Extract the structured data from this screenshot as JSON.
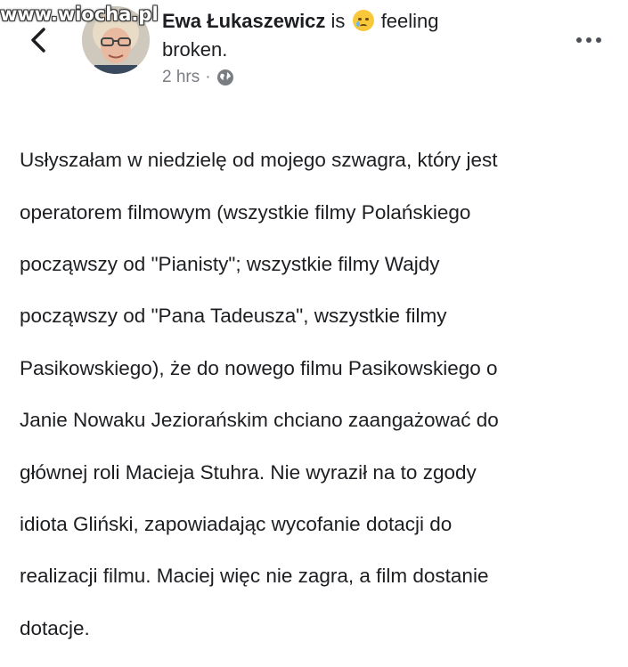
{
  "watermark": "www.wiocha.pl",
  "header": {
    "author_name": "Ewa Łukaszewicz",
    "is_text": "is",
    "feeling_emoji": "crying-face-icon",
    "feeling_text_1": "feeling",
    "feeling_text_2": "broken."
  },
  "meta": {
    "time": "2 hrs",
    "separator": "·",
    "privacy_icon": "globe-icon"
  },
  "post": {
    "lines": [
      "Usłyszałam w niedzielę od mojego szwagra, który jest",
      "operatorem filmowym (wszystkie filmy Polańskiego",
      "począwszy od \"Pianisty\"; wszystkie filmy Wajdy",
      "począwszy od \"Pana Tadeusza\", wszystkie filmy",
      "Pasikowskiego), że do nowego filmu Pasikowskiego o",
      "Janie Nowaku Jeziorańskim chciano zaangażować do",
      "głównej roli  Macieja Stuhra. Nie wyraził na to zgody",
      "idiota Gliński, zapowiadając wycofanie dotacji do",
      "realizacji filmu. Maciej więc nie zagra, a film dostanie",
      "dotacje."
    ]
  },
  "colors": {
    "text": "#1c1e21",
    "meta": "#7a7d82",
    "background": "#ffffff"
  }
}
